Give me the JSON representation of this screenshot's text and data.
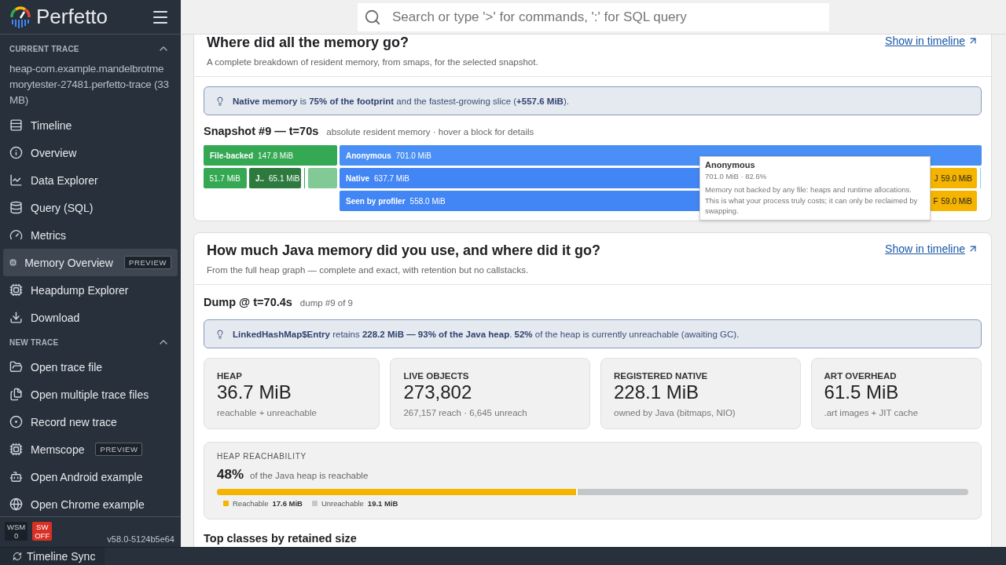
{
  "sidebar": {
    "title": "Perfetto",
    "sections": [
      {
        "heading": "CURRENT TRACE",
        "expanded": true,
        "trace_name": "heap-com.example.mandelbrotmemorytester-27481.perfetto-trace (33 MB)",
        "items": [
          {
            "label": "Timeline",
            "kind": "timeline",
            "selected": false
          },
          {
            "label": "Overview",
            "kind": "info",
            "selected": false
          },
          {
            "label": "Data Explorer",
            "kind": "chart",
            "selected": false
          },
          {
            "label": "Query (SQL)",
            "kind": "database",
            "selected": false
          },
          {
            "label": "Metrics",
            "kind": "gauge",
            "selected": false
          },
          {
            "label": "Memory Overview",
            "kind": "chip",
            "selected": true,
            "badge": "PREVIEW"
          },
          {
            "label": "Heapdump Explorer",
            "kind": "chip",
            "selected": false
          },
          {
            "label": "Download",
            "kind": "download",
            "selected": false
          }
        ]
      },
      {
        "heading": "NEW TRACE",
        "expanded": true,
        "items": [
          {
            "label": "Open trace file",
            "kind": "folder",
            "selected": false
          },
          {
            "label": "Open multiple trace files",
            "kind": "files",
            "selected": false
          },
          {
            "label": "Record new trace",
            "kind": "record",
            "selected": false
          },
          {
            "label": "Memscope",
            "kind": "chip",
            "selected": false,
            "badge": "PREVIEW"
          },
          {
            "label": "Open Android example",
            "kind": "android",
            "selected": false
          },
          {
            "label": "Open Chrome example",
            "kind": "globe",
            "selected": false
          }
        ]
      }
    ],
    "footer": {
      "wsm": [
        "WSM",
        "0"
      ],
      "sw": [
        "SW",
        "OFF"
      ],
      "version": "v58.0-5124b5e64"
    }
  },
  "search": {
    "placeholder": "Search or type '>' for commands, ':' for SQL query"
  },
  "memory_card": {
    "title": "Where did all the memory go?",
    "subtitle": "A complete breakdown of resident memory, from smaps, for the selected snapshot.",
    "link": "Show in timeline",
    "callout": "**Native memory** is **75% of the footprint** and the fastest-growing slice (**+557.6 MiB**).",
    "snapshot_title": "Snapshot #9 — t=70s",
    "snapshot_hint": "absolute resident memory · hover a block for details",
    "treemap": {
      "left": [
        {
          "label": "File-backed",
          "value": "147.8 MiB",
          "color": "#34a853"
        }
      ],
      "left_row": [
        {
          "value": "51.7 MiB",
          "color": "#34a853"
        },
        {
          "label": "J..",
          "value": "65.1 MiB",
          "color": "#2d7a3e"
        },
        {
          "color": "#81c995"
        }
      ],
      "right": [
        {
          "label": "Anonymous",
          "value": "701.0 MiB",
          "color": "#4a8ff5"
        },
        {
          "label": "Native",
          "value": "637.7 MiB",
          "color": "#4285f4",
          "side": {
            "label": "J",
            "value": "59.0 MiB",
            "color": "#f4b400"
          }
        },
        {
          "label": "Seen by profiler",
          "value": "558.0 MiB",
          "color": "#4285f4",
          "side": {
            "label": "F",
            "value": "59.0 MiB",
            "color": "#f4b400"
          }
        }
      ]
    },
    "tooltip": {
      "title": "Anonymous",
      "meta": "701.0 MiB · 82.6%",
      "text": "Memory not backed by any file: heaps and runtime allocations. This is what your process truly costs; it can only be reclaimed by swapping."
    }
  },
  "java_card": {
    "title": "How much Java memory did you use, and where did it go?",
    "subtitle": "From the full heap graph — complete and exact, with retention but no callstacks.",
    "link": "Show in timeline",
    "dump_title": "Dump @ t=70.4s",
    "dump_hint": "dump #9 of 9",
    "callout": "**LinkedHashMap$Entry** retains **228.2 MiB — 93% of the Java heap**. **52%** of the heap is currently unreachable (awaiting GC).",
    "metrics": [
      {
        "label": "HEAP",
        "value": "36.7 MiB",
        "note": "reachable + unreachable"
      },
      {
        "label": "LIVE OBJECTS",
        "value": "273,802",
        "note": "267,157 reach · 6,645 unreach"
      },
      {
        "label": "REGISTERED NATIVE",
        "value": "228.1 MiB",
        "note": "owned by Java (bitmaps, NIO)"
      },
      {
        "label": "ART OVERHEAD",
        "value": "61.5 MiB",
        "note": ".art images + JIT cache"
      }
    ],
    "reachability": {
      "heading": "HEAP REACHABILITY",
      "percent": "48%",
      "caption": "of the Java heap is reachable",
      "level": 0.48,
      "legend": [
        {
          "label": "Reachable",
          "value": "17.6 MiB",
          "color": "#f4b400"
        },
        {
          "label": "Unreachable",
          "value": "19.1 MiB",
          "color": "#c4c7ca"
        }
      ]
    },
    "next_heading": "Top classes by retained size"
  },
  "status_bar": {
    "label": "Timeline Sync"
  }
}
